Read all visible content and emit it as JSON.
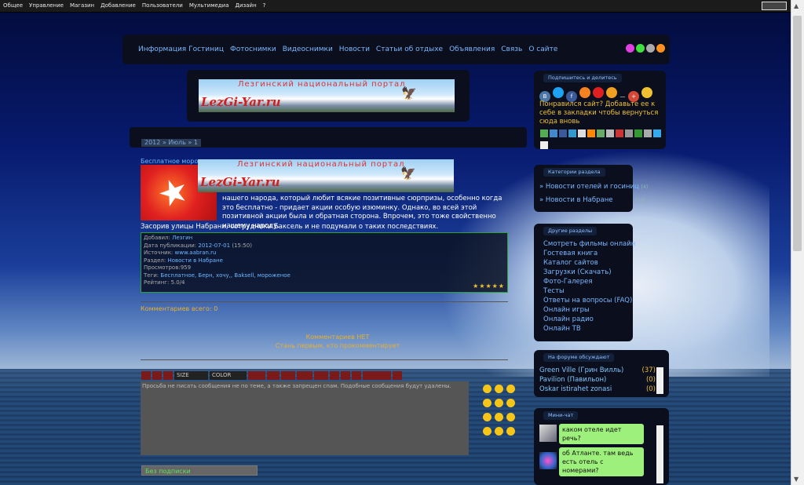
{
  "adminbar": {
    "items": [
      "Общее",
      "Управление",
      "Магазин",
      "Добавление",
      "Пользователи",
      "Мультимедиа",
      "Дизайн",
      "?"
    ]
  },
  "nav": {
    "items": [
      "Информация Гостиниц",
      "Фотоснимки",
      "Видеоснимки",
      "Новости",
      "Статьи об отдыхе",
      "Объявления",
      "Связь",
      "О сайте"
    ]
  },
  "banner": {
    "title": "Лезгинский национальный портал",
    "logo": "LezGi-Yar.ru"
  },
  "breadcrumb": "2012 » Июль » 1",
  "article": {
    "title": "Бесплатное моро",
    "body": "нашего народа, который любит всякие позитивные сюрпризы, особенно когда это бесплатно - придает акции особую изюминку. Однако, во всей этой позитивной акции была и обратная сторона. Впрочем, это тоже свойственно нашему народу.",
    "body2": "Засорив улицы Набрани, сотрудники Баксель и не подумали о таких последствиях.",
    "info": {
      "added_label": "Добавил:",
      "added_value": "Лезгин",
      "date_label": "Дата публикации:",
      "date_value": "2012-07-01",
      "time_value": "(15:50)",
      "source_label": "Источник:",
      "source_value": "www.aabran.ru",
      "section_label": "Раздел:",
      "section_value": "Новости в Набране",
      "views_label": "Просмотров:",
      "views_value": "959",
      "tags_label": "Теги:",
      "tags_value": "Бесплатное, Берн, хочу,, Baksell, мороженое",
      "rating_label": "Рейтинг:",
      "rating_value": "5.0/4",
      "stars": "★★★★★"
    }
  },
  "comments": {
    "total": "Комментариев всего: 0",
    "none": "Комментариев НЕТ",
    "first": "Стань первым, кто прокомментирует"
  },
  "editor": {
    "size_label": "SIZE",
    "color_label": "COLOR",
    "buttons": [
      "",
      "",
      "",
      "",
      "",
      "",
      "",
      "",
      "",
      "",
      "",
      "",
      ""
    ],
    "placeholder": "Просьба не писать сообщения не по теме, а также запрещен спам. Подобные сообщения будут удалены.",
    "signature_value": "Без подписки"
  },
  "right": {
    "share": {
      "title": "Подпишитесь и делитесь",
      "text": "Понравился сайт? Добавьте ее к себе в закладки чтобы вернуться сюда вновь"
    },
    "categories": {
      "title": "Категории раздела",
      "items": [
        {
          "label": "Новости отелей и госиниц",
          "count": "[4]"
        },
        {
          "label": "Новости в Набране",
          "count": "[13]"
        }
      ]
    },
    "sections": {
      "title": "Другие разделы",
      "items": [
        "Смотреть фильмы онлайн",
        "Гостевая книга",
        "Каталог сайтов",
        "Загрузки (Скачать)",
        "Фото-Галерея",
        "Тесты",
        "Ответы на вопросы (FAQ)",
        "Онлайн игры",
        "Онлайн радио",
        "Онлайн ТВ"
      ]
    },
    "forum": {
      "title": "На форуме обсуждают",
      "items": [
        {
          "label": "Green Ville (Грин Вилль)",
          "count": "(37)"
        },
        {
          "label": "Pavilion (Павильон)",
          "count": "(0)"
        },
        {
          "label": "Oskar istirahet zonasi",
          "count": "(0)"
        }
      ]
    },
    "chat": {
      "title": "Мини-чат",
      "messages": [
        "каком отеле идет речь?",
        "об Атланте. там ведь есть отель с номерами?"
      ]
    }
  }
}
